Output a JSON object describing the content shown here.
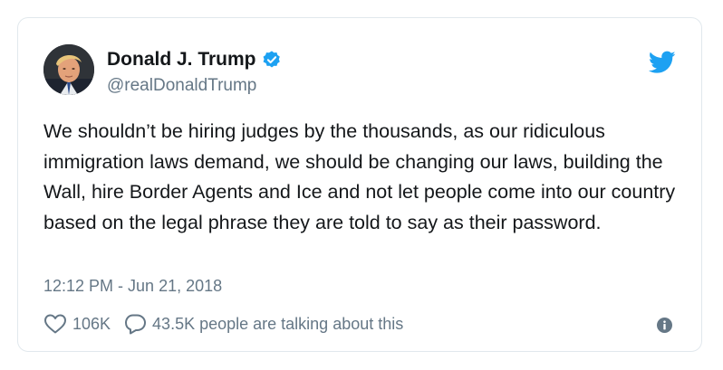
{
  "tweet": {
    "author": {
      "display_name": "Donald J. Trump",
      "handle": "@realDonaldTrump",
      "verified": true,
      "avatar_icon": "profile-photo"
    },
    "text": "We shouldn’t be hiring judges by the thousands, as our ridiculous immigration laws demand, we should be changing our laws, building the Wall, hire Border Agents and Ice and not let people come into our country based on the legal phrase they are told to say as their password.",
    "timestamp": "12:12 PM - Jun 21, 2018",
    "likes": "106K",
    "talking_text": "43.5K people are talking about this",
    "icons": {
      "brand": "twitter-bird-icon",
      "verified": "verified-badge-icon",
      "like": "heart-icon",
      "reply": "speech-bubble-icon",
      "info": "info-icon"
    }
  },
  "colors": {
    "brand_blue": "#1da1f2",
    "text_primary": "#14171a",
    "text_secondary": "#657786",
    "border": "#e1e8ed"
  }
}
